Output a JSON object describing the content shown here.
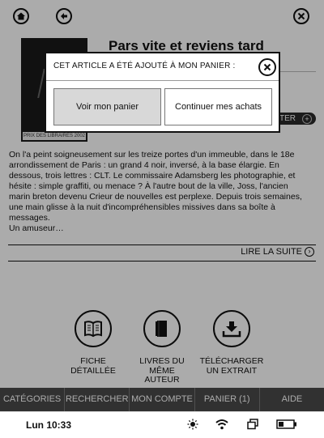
{
  "book": {
    "title": "Pars vite et reviens tard",
    "cover_label": "PRIX DES LIBRAIRES 2002",
    "buy_pill_label": "TER",
    "description_lines": [
      "On l'a peint soigneusement sur les treize portes d'un immeuble, dans le 18e",
      "arrondissement de Paris : un grand 4 noir, inversé, à la base élargie. En",
      "dessous, trois lettres : CLT. Le commissaire Adamsberg les photographie, et",
      "hésite : simple graffiti, ou menace ? À l'autre bout de la ville, Joss, l'ancien",
      "marin breton devenu Crieur de nouvelles est perplexe. Depuis trois semaines,",
      "une main glisse à la nuit d'incompréhensibles missives dans sa boîte à",
      "messages.",
      "Un amuseur…"
    ],
    "read_more": "LIRE LA SUITE"
  },
  "actions": [
    {
      "line1": "FICHE",
      "line2": "DÉTAILLÉE",
      "line3": ""
    },
    {
      "line1": "LIVRES DU",
      "line2": "MÊME",
      "line3": "AUTEUR"
    },
    {
      "line1": "TÉLÉCHARGER",
      "line2": "UN EXTRAIT",
      "line3": ""
    }
  ],
  "tabs": [
    "CATÉGORIES",
    "RECHERCHER",
    "MON COMPTE",
    "PANIER (1)",
    "AIDE"
  ],
  "modal": {
    "header": "CET ARTICLE A ÉTÉ AJOUTÉ À MON PANIER :",
    "view_cart": "Voir mon panier",
    "continue": "Continuer mes achats"
  },
  "status": {
    "time": "Lun 10:33"
  },
  "icons": {
    "home": "home-icon",
    "back": "back-arrow-icon",
    "close": "close-icon",
    "detail": "book-icon",
    "author": "books-icon",
    "download": "download-icon",
    "brightness": "brightness-icon",
    "wifi": "wifi-icon",
    "windows": "windows-icon",
    "battery": "battery-icon"
  }
}
